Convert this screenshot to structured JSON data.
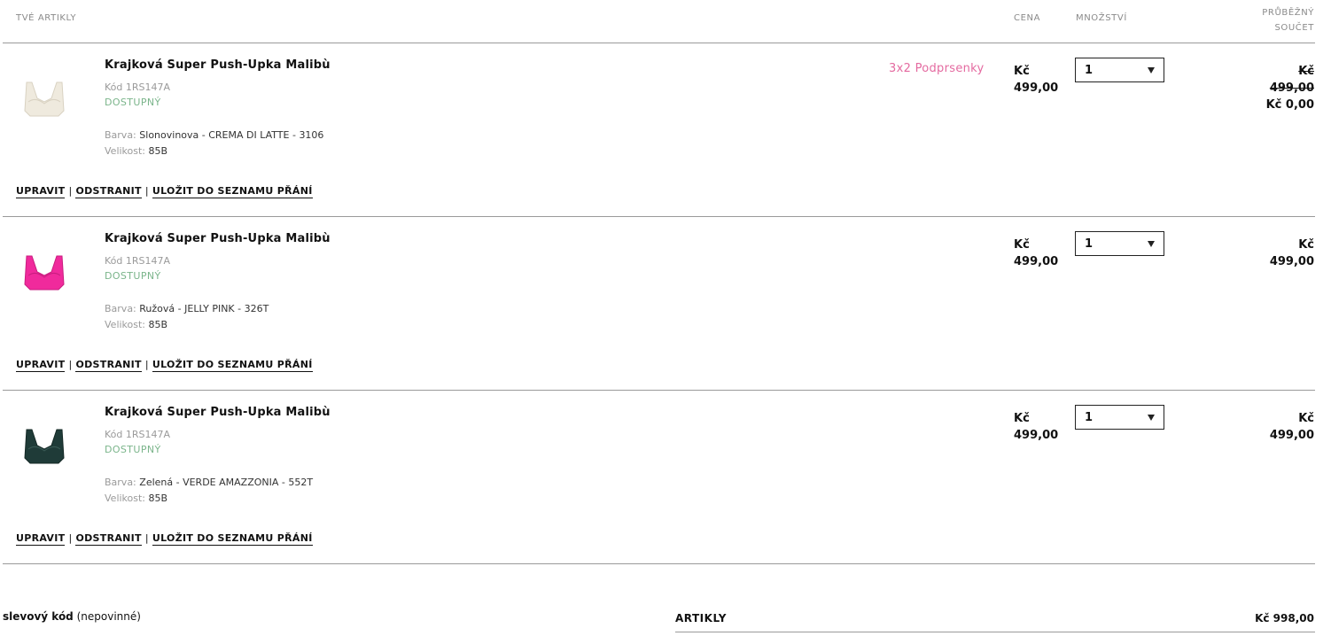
{
  "header": {
    "col_items": "TVÉ ARTIKLY",
    "col_price": "CENA",
    "col_qty": "MNOŽSTVÍ",
    "col_total_line1": "PRŮBĚŽNÝ",
    "col_total_line2": "SOUČET"
  },
  "items": [
    {
      "name": "Krajková Super Push-Upka Malibù",
      "code": "Kód  1RS147A",
      "availability": "DOSTUPNÝ",
      "color_label": "Barva:",
      "color_value": "Slonovinova - CREMA DI LATTE - 3106",
      "size_label": "Velikost:",
      "size_value": "85B",
      "promo": "3x2 Podprsenky",
      "price_currency": "Kč",
      "price_amount": "499,00",
      "qty": "1",
      "total_currency": "Kč",
      "total_amount": "499,00",
      "total_discounted": "Kč 0,00",
      "swatch": "#efeade",
      "action_edit": "UPRAVIT",
      "action_remove": "ODSTRANIT",
      "action_wishlist": "ULOŽIT DO SEZNAMU PŘÁNÍ"
    },
    {
      "name": "Krajková Super Push-Upka Malibù",
      "code": "Kód  1RS147A",
      "availability": "DOSTUPNÝ",
      "color_label": "Barva:",
      "color_value": "Ružová - JELLY PINK - 326T",
      "size_label": "Velikost:",
      "size_value": "85B",
      "price_currency": "Kč",
      "price_amount": "499,00",
      "qty": "1",
      "total_currency": "Kč",
      "total_amount": "499,00",
      "swatch": "#f02a9c",
      "action_edit": "UPRAVIT",
      "action_remove": "ODSTRANIT",
      "action_wishlist": "ULOŽIT DO SEZNAMU PŘÁNÍ"
    },
    {
      "name": "Krajková Super Push-Upka Malibù",
      "code": "Kód  1RS147A",
      "availability": "DOSTUPNÝ",
      "color_label": "Barva:",
      "color_value": "Zelená - VERDE AMAZZONIA - 552T",
      "size_label": "Velikost:",
      "size_value": "85B",
      "price_currency": "Kč",
      "price_amount": "499,00",
      "qty": "1",
      "total_currency": "Kč",
      "total_amount": "499,00",
      "swatch": "#1f3b38",
      "action_edit": "UPRAVIT",
      "action_remove": "ODSTRANIT",
      "action_wishlist": "ULOŽIT DO SEZNAMU PŘÁNÍ"
    }
  ],
  "footer": {
    "discount_label": "slevový kód",
    "discount_optional": "(nepovinné)",
    "summary_label": "ARTIKLY",
    "summary_value": "Kč 998,00"
  }
}
